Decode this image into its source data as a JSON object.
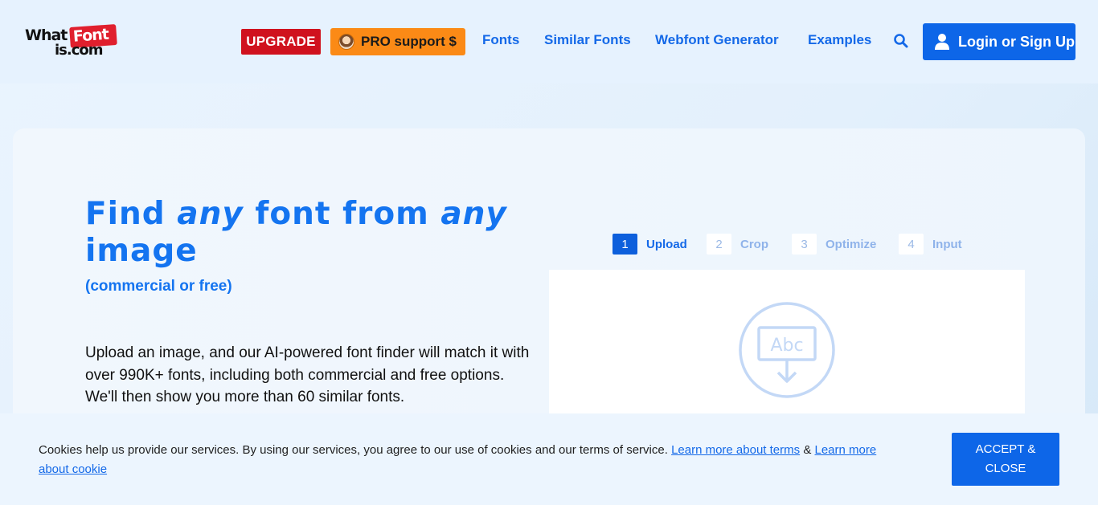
{
  "header": {
    "logo": {
      "what": "What",
      "font": "Font",
      "iscom": "is.com"
    },
    "upgrade_label": "UPGRADE",
    "pro_support_label": "PRO support $",
    "nav": [
      {
        "label": "Fonts"
      },
      {
        "label": "Similar Fonts"
      },
      {
        "label": "Webfont Generator"
      },
      {
        "label": "Examples"
      }
    ],
    "search_icon": "search-icon",
    "login_label": "Login or Sign Up"
  },
  "hero": {
    "title_part1": "Find",
    "title_em1": "any",
    "title_part2": "font from",
    "title_em2": "any",
    "title_part3": "image",
    "subtitle": "(commercial or free)",
    "description": "Upload an image, and our AI-powered font finder will match it with over 990K+ fonts, including both commercial and free options. We'll then show you more than 60 similar fonts."
  },
  "steps": [
    {
      "num": "1",
      "label": "Upload",
      "active": true
    },
    {
      "num": "2",
      "label": "Crop",
      "active": false
    },
    {
      "num": "3",
      "label": "Optimize",
      "active": false
    },
    {
      "num": "4",
      "label": "Input",
      "active": false
    }
  ],
  "upload": {
    "icon_text": "Abc",
    "icon": "upload-image-icon"
  },
  "cookie": {
    "text": "Cookies help us provide our services. By using our services, you agree to our use of cookies and our terms of service.",
    "terms_link": "Learn more about terms",
    "amp": "&",
    "cookie_link": "Learn more about cookie",
    "accept_label": "ACCEPT & CLOSE"
  },
  "colors": {
    "accent": "#1469e8",
    "upgrade": "#d0121e",
    "pro": "#fb8a16",
    "logo_red": "#e01f2d"
  }
}
